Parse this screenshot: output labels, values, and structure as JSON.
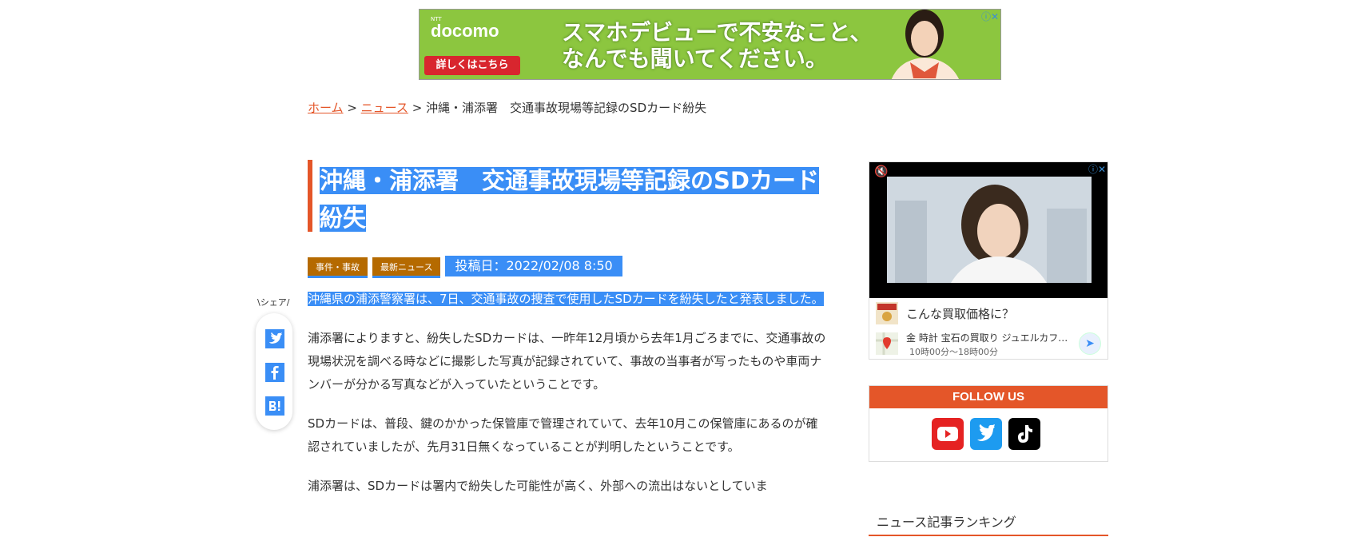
{
  "top_ad": {
    "brand_small": "NTT",
    "brand": "docomo",
    "cta": "詳しくはこちら",
    "copy_line1": "スマホデビューで不安なこと、",
    "copy_line2": "なんでも聞いてください。",
    "bg_color": "#8cc63f"
  },
  "breadcrumb": {
    "home": "ホーム",
    "sep1": " > ",
    "news": "ニュース",
    "sep2": " > ",
    "current": "沖縄・浦添署　交通事故現場等記録のSDカード紛失"
  },
  "article": {
    "title": "沖縄・浦添署　交通事故現場等記録のSDカード紛失",
    "tags": [
      "事件・事故",
      "最新ニュース"
    ],
    "posted": "投稿日：2022/02/08 8:50",
    "paragraphs": [
      "沖縄県の浦添警察署は、7日、交通事故の捜査で使用したSDカードを紛失したと発表しました。",
      "浦添署によりますと、紛失したSDカードは、一昨年12月頃から去年1月ごろまでに、交通事故の現場状況を調べる時などに撮影した写真が記録されていて、事故の当事者が写ったものや車両ナンバーが分かる写真などが入っていたということです。",
      "SDカードは、普段、鍵のかかった保管庫で管理されていて、去年10月この保管庫にあるのが確認されていましたが、先月31日無くなっていることが判明したということです。",
      "浦添署は、SDカードは署内で紛失した可能性が高く、外部への流出はないとしていま"
    ]
  },
  "share": {
    "label": "\\シェア/",
    "buttons": [
      "twitter-icon",
      "facebook-icon",
      "hatena-bookmark-icon"
    ]
  },
  "side_ad": {
    "row1_text": "こんな買取価格に？",
    "row2_text": "金 時計 宝石の買取り ジュエルカフ…",
    "row2_sub": "10時00分〜18時00分"
  },
  "follow": {
    "heading": "FOLLOW US",
    "icons": [
      "youtube-icon",
      "twitter-icon",
      "tiktok-icon"
    ]
  },
  "ranking": {
    "title": "ニュース記事ランキング"
  },
  "colors": {
    "accent": "#e45629",
    "selection": "#3a8ef6",
    "tag_bg": "#b56a00"
  }
}
